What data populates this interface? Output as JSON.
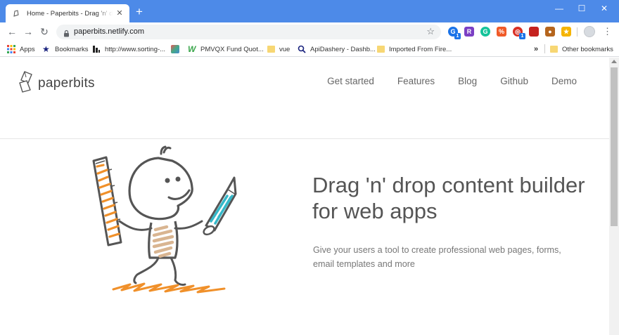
{
  "browser": {
    "tab_title": "Home - Paperbits - Drag 'n' drop content builder",
    "url": "paperbits.netlify.com",
    "colors": {
      "chrome_blue": "#4d8ae8",
      "omnibox": "#f1f3f4"
    },
    "extensions": [
      {
        "name": "grammar-extension-icon",
        "label": "G",
        "color": "#1a73e8",
        "badge": "1"
      },
      {
        "name": "r-extension-icon",
        "label": "R",
        "color": "#7b3fc4",
        "badge": ""
      },
      {
        "name": "grammarly-icon",
        "label": "G",
        "color": "#15c39a",
        "badge": ""
      },
      {
        "name": "percent-extension-icon",
        "label": "%",
        "color": "#f05a28",
        "badge": ""
      },
      {
        "name": "target-extension-icon",
        "label": "◎",
        "color": "#d93025",
        "badge": "1"
      },
      {
        "name": "square-extension-icon",
        "label": "",
        "color": "#c5221f",
        "badge": ""
      },
      {
        "name": "cookie-extension-icon",
        "label": "●",
        "color": "#b5651d",
        "badge": ""
      },
      {
        "name": "star-extension-icon",
        "label": "★",
        "color": "#f5b400",
        "badge": ""
      }
    ]
  },
  "bookmarks": {
    "items": [
      {
        "label": "Apps",
        "icon": "apps-grid-icon"
      },
      {
        "label": "Bookmarks",
        "icon": "star-icon"
      },
      {
        "label": "http://www.sorting-...",
        "icon": "bars-icon"
      },
      {
        "label": "",
        "icon": "image-icon"
      },
      {
        "label": "PMVQX Fund Quot...",
        "icon": "w-logo-icon"
      },
      {
        "label": "vue",
        "icon": "folder-icon"
      },
      {
        "label": "ApiDashery - Dashb...",
        "icon": "search-icon"
      },
      {
        "label": "Imported From Fire...",
        "icon": "folder-icon"
      }
    ],
    "overflow": "»",
    "other": "Other bookmarks"
  },
  "site": {
    "logo_text": "paperbits",
    "nav": [
      "Get started",
      "Features",
      "Blog",
      "Github",
      "Demo"
    ],
    "hero_title": "Drag 'n' drop content builder for web apps",
    "hero_subtitle": "Give your users a tool to create professional web pages, forms, email templates and more",
    "colors": {
      "orange": "#f0902a",
      "teal": "#35b8c9",
      "beige": "#d9b591",
      "ink": "#555555"
    }
  }
}
